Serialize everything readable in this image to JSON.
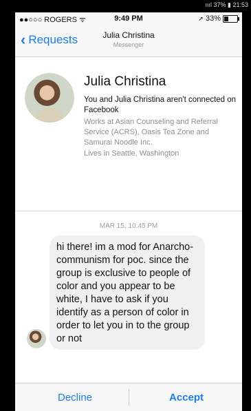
{
  "status_bar": {
    "carrier": "●●○○○ ROGERS ᯤ",
    "time": "9:49 PM",
    "battery": "33%",
    "battery_level": 0.33
  },
  "outer_strip": {
    "text": "ıııl 37% ▮ 21:53"
  },
  "navbar": {
    "back_label": "Requests",
    "title": "Julia Christina",
    "subtitle": "Messenger"
  },
  "profile": {
    "name": "Julia Christina",
    "connection": "You and Julia Christina aren't connected on Facebook",
    "work": "Works at Asian Counseling and Referral Service (ACRS), Oasis Tea Zone and Samurai Noodle Inc.",
    "lives": "Lives in Seattle, Washington"
  },
  "message": {
    "timestamp": "MAR 15, 10:45 PM",
    "text": "hi there! im a mod for Anarcho-communism for poc. since the group is exclusive to people of color and you appear to be white, I have to ask if you identify as a person of color in order to let you in to the group or not"
  },
  "actions": {
    "decline": "Decline",
    "accept": "Accept"
  },
  "colors": {
    "accent": "#1a7cf4",
    "bubble": "#f0f0f0",
    "secondary_text": "#8e8e93"
  }
}
